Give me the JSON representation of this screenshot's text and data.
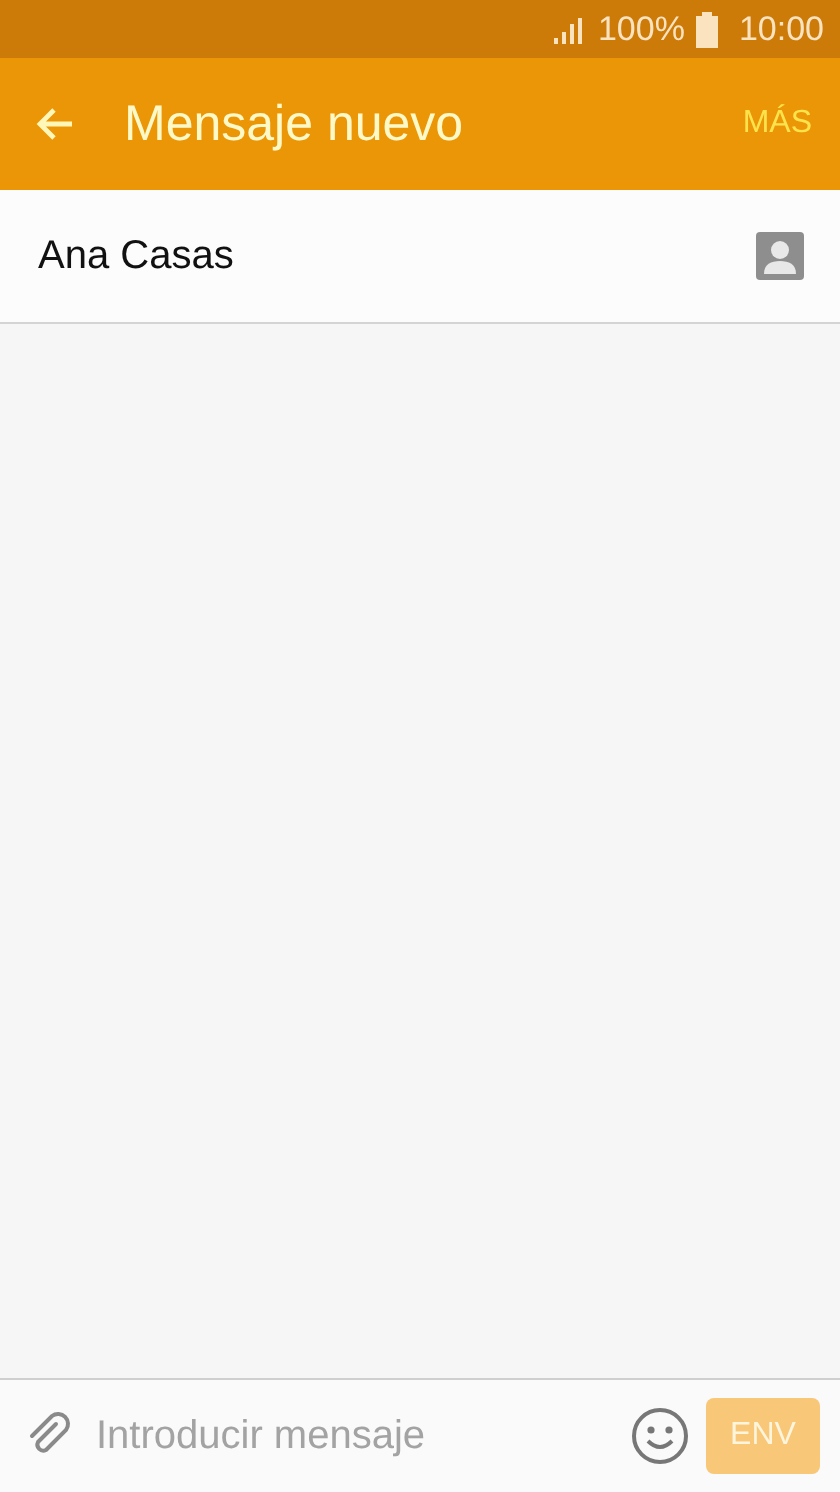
{
  "status_bar": {
    "battery": "100%",
    "time": "10:00"
  },
  "app_bar": {
    "title": "Mensaje nuevo",
    "action": "MÁS"
  },
  "recipient": {
    "name": "Ana Casas"
  },
  "composer": {
    "placeholder": "Introducir mensaje",
    "send": {
      "label": "ENV",
      "disabled": true
    }
  }
}
